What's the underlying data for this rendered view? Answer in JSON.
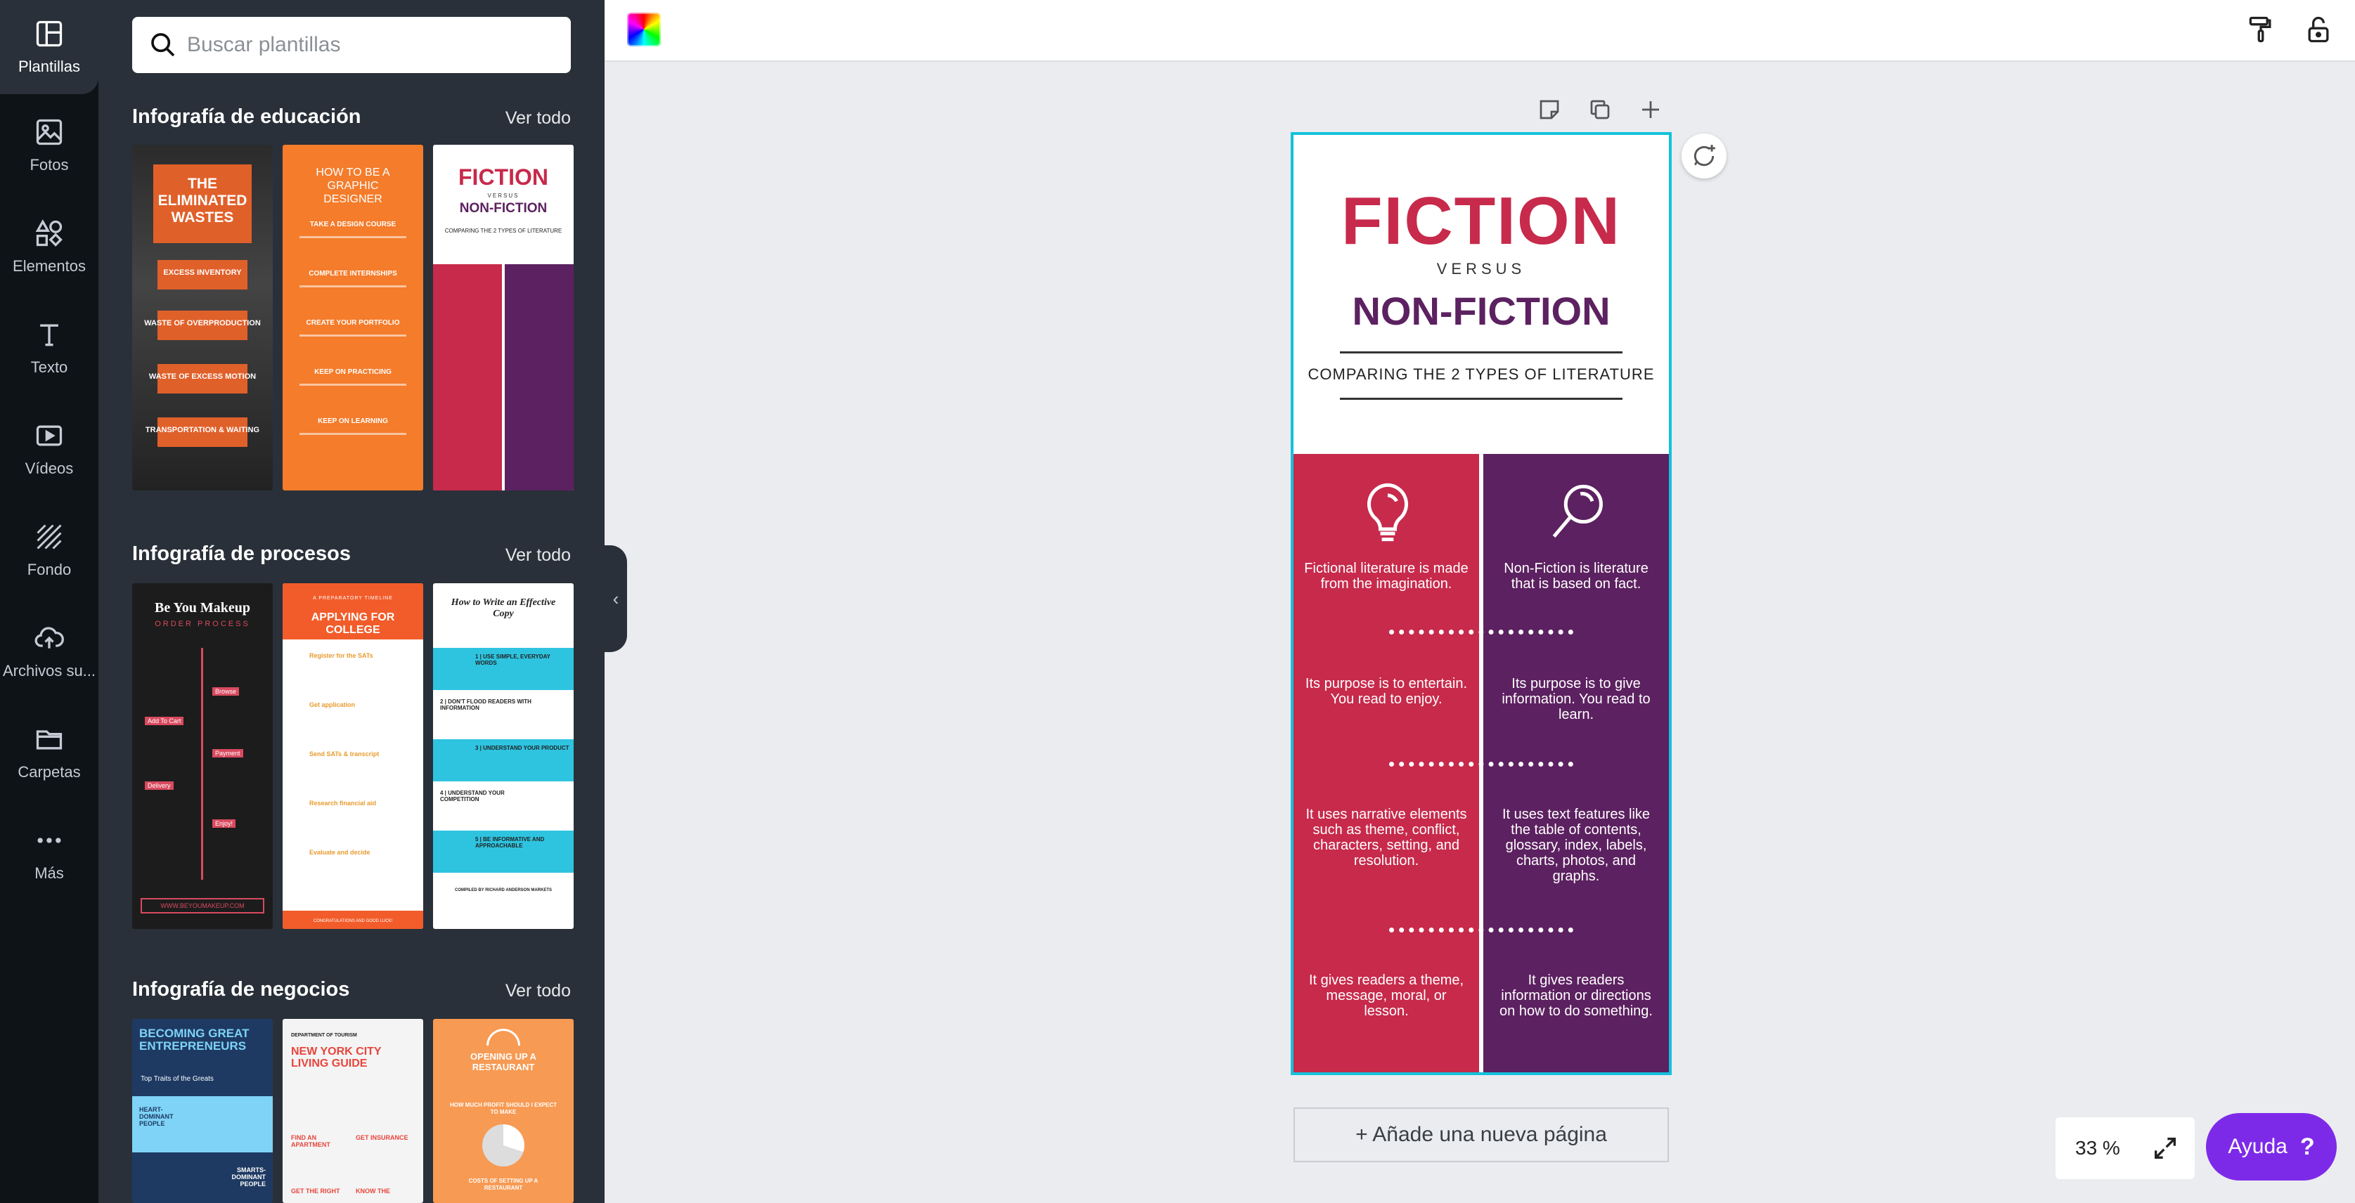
{
  "sidebar": {
    "items": [
      {
        "label": "Plantillas",
        "icon": "templates-icon",
        "active": true
      },
      {
        "label": "Fotos",
        "icon": "photos-icon"
      },
      {
        "label": "Elementos",
        "icon": "elements-icon"
      },
      {
        "label": "Texto",
        "icon": "text-icon"
      },
      {
        "label": "Vídeos",
        "icon": "video-icon"
      },
      {
        "label": "Fondo",
        "icon": "background-icon"
      },
      {
        "label": "Archivos su...",
        "icon": "upload-icon"
      },
      {
        "label": "Carpetas",
        "icon": "folder-icon"
      },
      {
        "label": "Más",
        "icon": "more-icon"
      }
    ]
  },
  "search": {
    "placeholder": "Buscar plantillas"
  },
  "sections": [
    {
      "title": "Infografía de educación",
      "link": "Ver todo",
      "thumbs": [
        {
          "title": "THE ELIMINATED WASTES",
          "items": [
            "EXCESS INVENTORY",
            "WASTE OF OVERPRODUCTION",
            "WASTE OF EXCESS MOTION",
            "TRANSPORTATION & WAITING"
          ]
        },
        {
          "title": "HOW TO BE A GRAPHIC DESIGNER",
          "items": [
            "TAKE A DESIGN COURSE",
            "COMPLETE INTERNSHIPS",
            "CREATE YOUR PORTFOLIO",
            "KEEP ON PRACTICING",
            "KEEP ON LEARNING"
          ]
        },
        {
          "title": "FICTION",
          "versus": "VERSUS",
          "title2": "NON-FICTION",
          "subtitle": "COMPARING THE 2 TYPES OF LITERATURE"
        }
      ]
    },
    {
      "title": "Infografía de procesos",
      "link": "Ver todo",
      "thumbs": [
        {
          "title": "Be You Makeup",
          "subtitle": "ORDER PROCESS",
          "tags": [
            "Browse",
            "Add To Cart",
            "Payment",
            "Delivery",
            "Enjoy!"
          ],
          "url": "WWW.BEYOUMAKEUP.COM"
        },
        {
          "kicker": "A PREPARATORY TIMELINE",
          "title": "APPLYING FOR COLLEGE",
          "items": [
            "Register for the SATs",
            "Get application",
            "Send SATs & transcript",
            "Research financial aid",
            "Evaluate and decide"
          ],
          "footer": "CONGRATULATIONS AND GOOD LUCK!"
        },
        {
          "title": "How to Write an Effective Copy",
          "items": [
            "1 | USE SIMPLE, EVERYDAY WORDS",
            "2 | DON'T FLOOD READERS WITH INFORMATION",
            "3 | UNDERSTAND YOUR PRODUCT",
            "4 | UNDERSTAND YOUR COMPETITION",
            "5 | BE INFORMATIVE AND APPROACHABLE"
          ],
          "footer": "COMPILED BY RICHARD ANDERSON MARKETS"
        }
      ]
    },
    {
      "title": "Infografía de negocios",
      "link": "Ver todo",
      "thumbs": [
        {
          "title": "BECOMING GREAT ENTREPRENEURS",
          "subtitle": "Top Traits of the Greats",
          "items": [
            "HEART-DOMINANT PEOPLE",
            "SMARTS-DOMINANT PEOPLE"
          ]
        },
        {
          "kicker": "DEPARTMENT OF TOURISM",
          "title": "NEW YORK CITY LIVING GUIDE",
          "items": [
            "FIND AN APARTMENT",
            "GET INSURANCE",
            "GET THE RIGHT",
            "KNOW THE"
          ]
        },
        {
          "title": "OPENING UP A RESTAURANT",
          "items": [
            "HOW MUCH PROFIT SHOULD I EXPECT TO MAKE",
            "COSTS OF SETTING UP A RESTAURANT"
          ]
        }
      ]
    }
  ],
  "document": {
    "title1": "FICTION",
    "versus": "VERSUS",
    "title2": "NON-FICTION",
    "subtitle": "COMPARING THE 2 TYPES OF LITERATURE",
    "left": [
      "Fictional literature is made from the imagination.",
      "Its purpose is to entertain. You read to enjoy.",
      "It uses narrative elements such as theme, conflict, characters, setting, and resolution.",
      "It gives readers a theme, message, moral, or lesson."
    ],
    "right": [
      "Non-Fiction is literature that is based on fact.",
      "Its purpose is to give information. You read to learn.",
      "It uses text features like the table of contents, glossary, index, labels, charts, photos, and graphs.",
      "It gives readers information or directions on how to do something."
    ]
  },
  "add_page_label": "+ Añade una nueva página",
  "zoom": "33 %",
  "help": {
    "label": "Ayuda",
    "icon": "?"
  },
  "colors": {
    "rail": "#0e1318",
    "panel": "#293039",
    "fiction_red": "#c72a4b",
    "nonfiction_purple": "#5c2160",
    "selection": "#13c1dc",
    "help": "#7d2ae8"
  }
}
